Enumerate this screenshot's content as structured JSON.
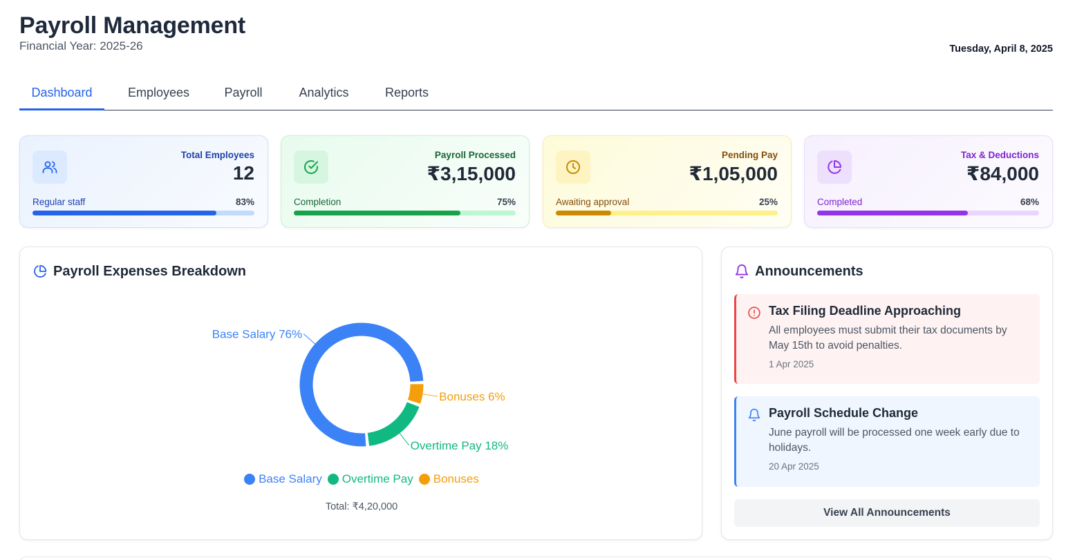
{
  "header": {
    "title": "Payroll Management",
    "subtitle": "Financial Year: 2025-26",
    "date": "Tuesday, April 8, 2025"
  },
  "tabs": [
    {
      "label": "Dashboard",
      "active": true
    },
    {
      "label": "Employees",
      "active": false
    },
    {
      "label": "Payroll",
      "active": false
    },
    {
      "label": "Analytics",
      "active": false
    },
    {
      "label": "Reports",
      "active": false
    }
  ],
  "stats": [
    {
      "label": "Total Employees",
      "value": "12",
      "foot_label": "Regular staff",
      "percent": "83%",
      "progress": 0.83,
      "icon": "users-icon",
      "accent": "#2563eb",
      "label_color": "#1e40af",
      "bg": "#eaf2fe",
      "border": "#cfe0fb",
      "track": "#bfdbfe",
      "icon_bg": "#dbeafe"
    },
    {
      "label": "Payroll Processed",
      "value": "₹3,15,000",
      "foot_label": "Completion",
      "percent": "75%",
      "progress": 0.75,
      "icon": "check-circle-icon",
      "accent": "#16a34a",
      "label_color": "#166534",
      "bg": "#e8fbee",
      "border": "#c9f0d5",
      "track": "#bbf7d0",
      "icon_bg": "#d7f6e1"
    },
    {
      "label": "Pending Pay",
      "value": "₹1,05,000",
      "foot_label": "Awaiting approval",
      "percent": "25%",
      "progress": 0.25,
      "icon": "clock-icon",
      "accent": "#ca8a04",
      "label_color": "#854d0e",
      "bg": "#fefbd9",
      "border": "#f7eeb0",
      "track": "#fef08a",
      "icon_bg": "#fdf4c2"
    },
    {
      "label": "Tax & Deductions",
      "value": "₹84,000",
      "foot_label": "Completed",
      "percent": "68%",
      "progress": 0.68,
      "icon": "pie-chart-icon",
      "accent": "#9333ea",
      "label_color": "#7e22ce",
      "bg": "#f6f0fe",
      "border": "#e9dcfb",
      "track": "#e9d5ff",
      "icon_bg": "#ede0fd"
    }
  ],
  "breakdown": {
    "title": "Payroll Expenses Breakdown",
    "total": "Total: ₹4,20,000"
  },
  "chart_data": {
    "type": "pie",
    "categories": [
      "Base Salary",
      "Overtime Pay",
      "Bonuses"
    ],
    "values": [
      76,
      18,
      6
    ],
    "slice_labels": [
      "Base Salary 76%",
      "Overtime Pay 18%",
      "Bonuses 6%"
    ],
    "colors": [
      "#3b82f6",
      "#10b981",
      "#f59e0b"
    ],
    "legend_position": "bottom"
  },
  "announcements": {
    "title": "Announcements",
    "items": [
      {
        "title": "Tax Filing Deadline Approaching",
        "body": "All employees must submit their tax documents by May 15th to avoid penalties.",
        "date": "1 Apr 2025",
        "icon": "alert-circle-icon",
        "accent": "#ef4444",
        "bg": "#fef2f2"
      },
      {
        "title": "Payroll Schedule Change",
        "body": "June payroll will be processed one week early due to holidays.",
        "date": "20 Apr 2025",
        "icon": "bell-icon",
        "accent": "#3b82f6",
        "bg": "#eff6ff"
      }
    ],
    "view_all_label": "View All Announcements"
  }
}
